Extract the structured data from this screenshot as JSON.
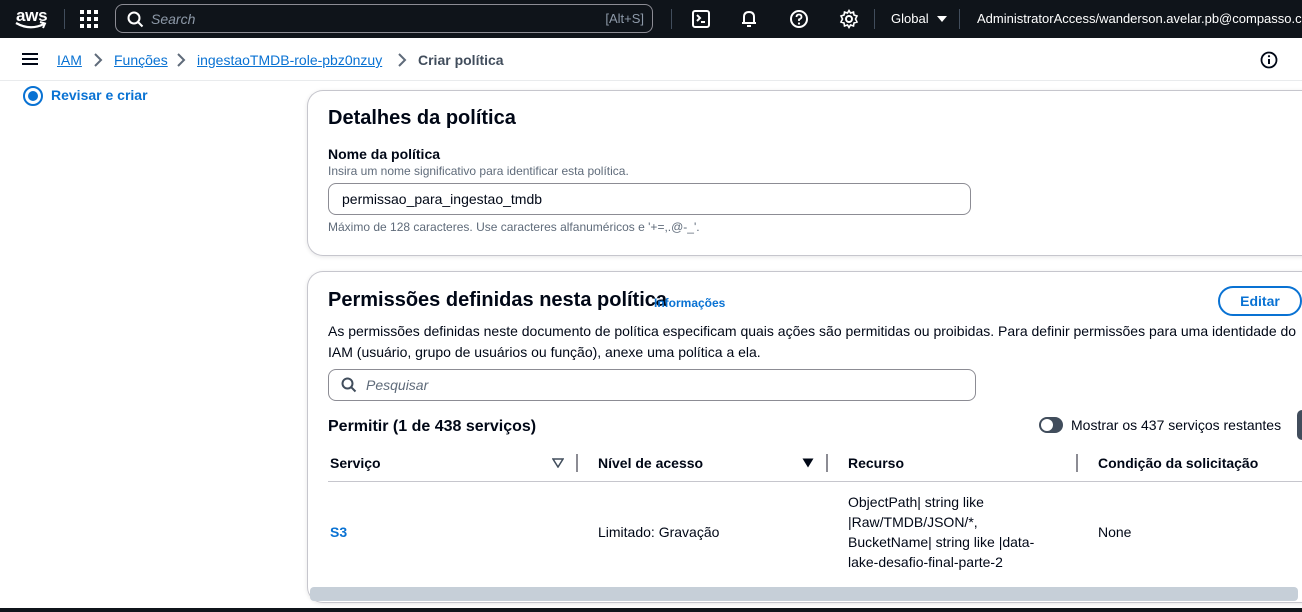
{
  "topnav": {
    "logo_text": "aws",
    "search_placeholder": "Search",
    "search_shortcut": "[Alt+S]",
    "icons": [
      "apps-grid-icon",
      "cloudshell-icon",
      "bell-icon",
      "help-icon",
      "gear-icon"
    ],
    "region": "Global",
    "account": "AdministratorAccess/wanderson.avelar.pb@compasso.com."
  },
  "breadcrumb": {
    "items": [
      "IAM",
      "Funções",
      "ingestaoTMDB-role-pbz0nzuy"
    ],
    "current": "Criar política"
  },
  "steps": {
    "current_label": "Revisar e criar"
  },
  "details": {
    "title": "Detalhes da política",
    "name_label": "Nome da política",
    "name_desc": "Insira um nome significativo para identificar esta política.",
    "name_value": "permissao_para_ingestao_tmdb",
    "name_hint": "Máximo de 128 caracteres. Use caracteres alfanuméricos e '+=,.@-_'."
  },
  "permissions": {
    "title": "Permissões definidas nesta política",
    "info_link": "Informações",
    "edit_button": "Editar",
    "description": "As permissões definidas neste documento de política especificam quais ações são permitidas ou proibidas. Para definir permissões para uma identidade do IAM (usuário, grupo de usuários ou função), anexe uma política a ela.",
    "search_placeholder": "Pesquisar",
    "allow_heading": "Permitir (1 de 438 serviços)",
    "toggle_label": "Mostrar os 437 serviços restantes",
    "toggle_on": false,
    "columns": [
      "Serviço",
      "Nível de acesso",
      "Recurso",
      "Condição da solicitação"
    ],
    "rows": [
      {
        "service": "S3",
        "access_level": "Limitado: Gravação",
        "resource_lines": [
          "ObjectPath| string like",
          "|Raw/TMDB/JSON/*,",
          "BucketName| string like |data-",
          "lake-desafio-final-parte-2"
        ],
        "condition": "None"
      }
    ]
  },
  "colors": {
    "nav_bg": "#0f141a",
    "link": "#0972d3",
    "text": "#000716",
    "muted": "#5f6b7a"
  }
}
